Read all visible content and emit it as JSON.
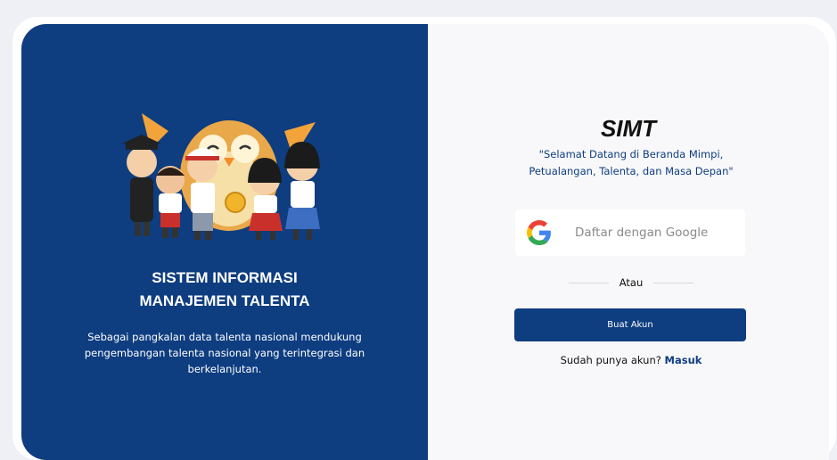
{
  "brand": {
    "primary_color": "#0e3d80",
    "background_color": "#f8f8fa"
  },
  "left_panel": {
    "illustration": "students-and-owl-mascot-illustration",
    "title_line1": "SISTEM INFORMASI",
    "title_line2": "MANAJEMEN TALENTA",
    "description_line1": "Sebagai pangkalan data talenta nasional mendukung",
    "description_line2": "pengembangan talenta nasional yang terintegrasi dan",
    "description_line3": "berkelanjutan."
  },
  "right_panel": {
    "app_name": "SIMT",
    "tagline_line1": "\"Selamat Datang di Beranda Mimpi,",
    "tagline_line2": "Petualangan, Talenta, dan Masa Depan\"",
    "google_button": {
      "icon": "google-icon",
      "label": "Daftar dengan Google"
    },
    "divider_text": "Atau",
    "create_account_label": "Buat Akun",
    "login_prompt": "Sudah punya akun?",
    "login_link": "Masuk"
  }
}
